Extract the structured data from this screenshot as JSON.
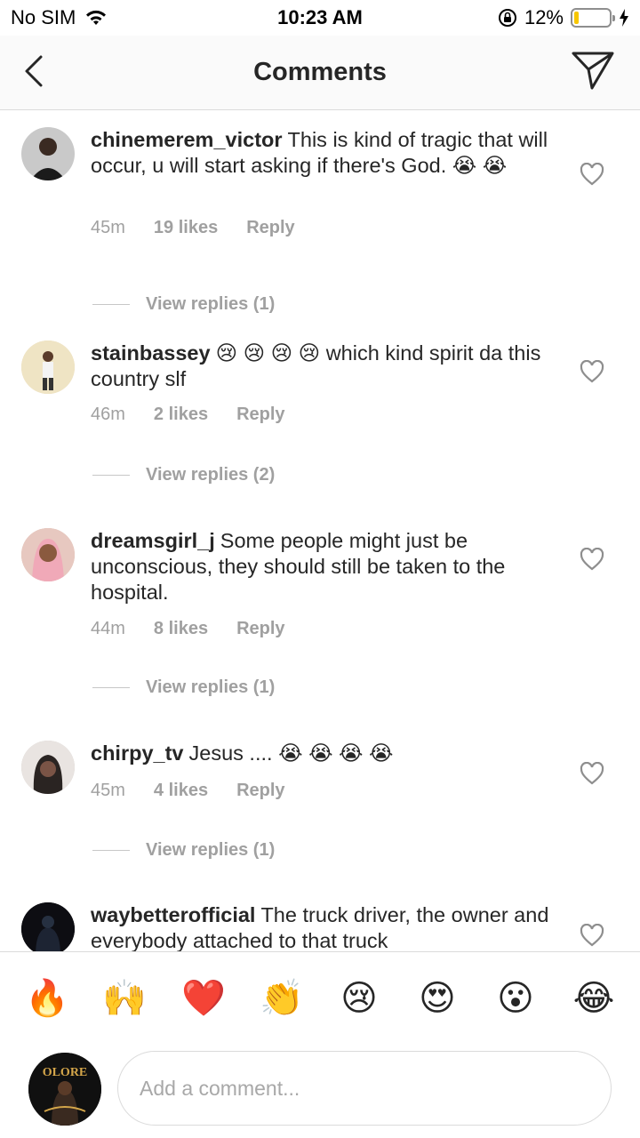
{
  "status": {
    "carrier": "No SIM",
    "time": "10:23 AM",
    "battery_pct": "12%",
    "battery_level": 0.12
  },
  "nav": {
    "title": "Comments",
    "back_icon": "chevron-left-icon",
    "send_icon": "paper-plane-icon"
  },
  "comments": [
    {
      "username": "chinemerem_victor",
      "text": "This is kind of tragic that will occur, u will start asking if there's God.",
      "emojis": [
        "😭",
        "😭"
      ],
      "time": "45m",
      "likes": "19 likes",
      "reply": "Reply",
      "view_replies": "View replies (1)"
    },
    {
      "username": "stainbassey",
      "text": "which kind spirit da this country slf",
      "emojis": [
        "😢",
        "😢",
        "😢",
        "😢"
      ],
      "time": "46m",
      "likes": "2 likes",
      "reply": "Reply",
      "view_replies": "View replies (2)"
    },
    {
      "username": "dreamsgirl_j",
      "text": "Some people might just be unconscious, they should still be taken to the hospital.",
      "emojis": [],
      "time": "44m",
      "likes": "8 likes",
      "reply": "Reply",
      "view_replies": "View replies (1)"
    },
    {
      "username": "chirpy_tv",
      "text": "Jesus ....",
      "emojis": [
        "😭",
        "😭",
        "😭",
        "😭"
      ],
      "time": "45m",
      "likes": "4 likes",
      "reply": "Reply",
      "view_replies": "View replies (1)"
    },
    {
      "username": "waybetterofficial",
      "text": "The truck driver, the owner and everybody attached to that truck",
      "emojis": []
    }
  ],
  "reactions": [
    "🔥",
    "🙌",
    "❤️",
    "👏",
    "😢",
    "😍",
    "😮",
    "😂"
  ],
  "input": {
    "placeholder": "Add a comment...",
    "avatar_text": "OLORE"
  }
}
